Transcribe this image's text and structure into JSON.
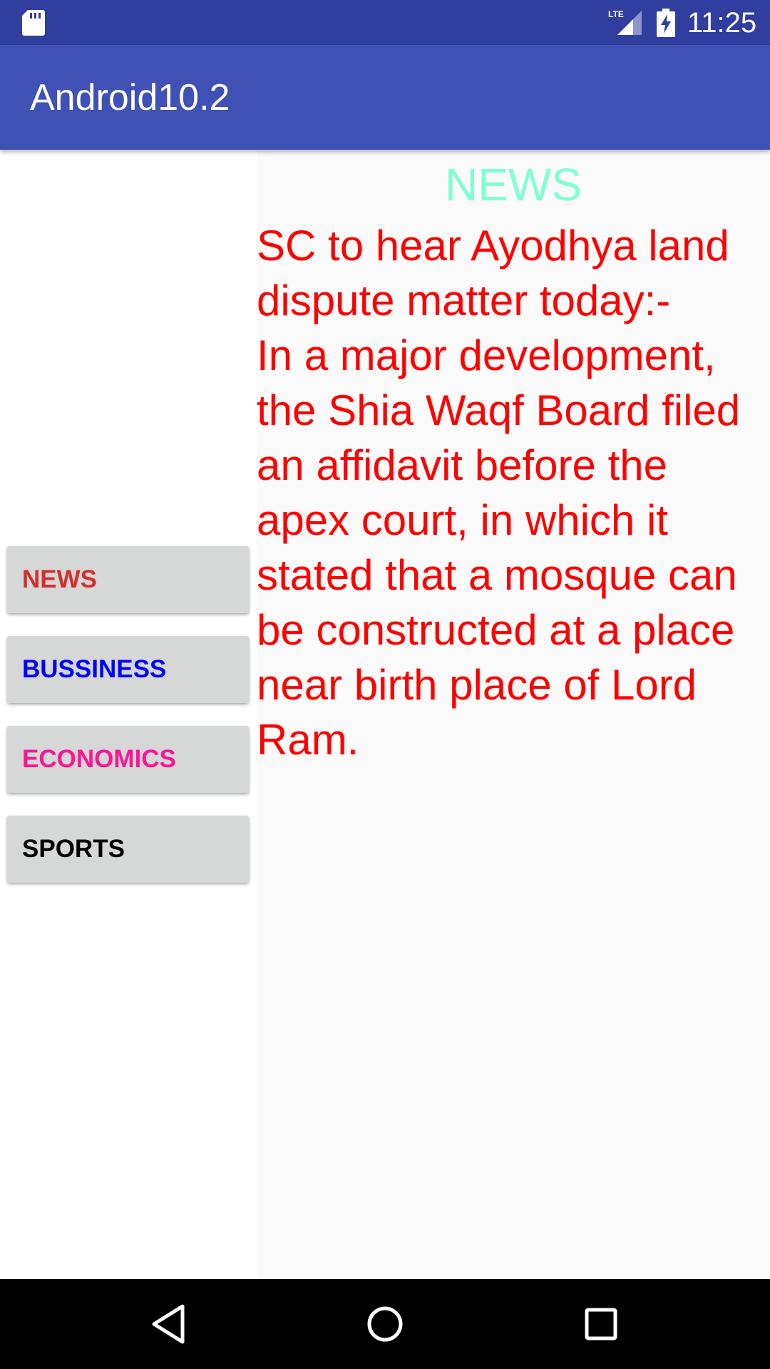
{
  "status_bar": {
    "time": "11:25",
    "icons": [
      "sd-card-icon",
      "lte-signal-icon",
      "battery-charging-icon"
    ]
  },
  "app_bar": {
    "title": "Android10.2"
  },
  "menu": {
    "buttons": [
      {
        "label": "NEWS",
        "color": "#d32f2f"
      },
      {
        "label": "BUSSINESS",
        "color": "#0000ff"
      },
      {
        "label": "ECONOMICS",
        "color": "#ff1493"
      },
      {
        "label": "SPORTS",
        "color": "#000000"
      }
    ]
  },
  "content": {
    "heading": "NEWS",
    "heading_color": "#7FFFD4",
    "body": "SC to hear Ayodhya land dispute matter today:-\nIn a major development, the Shia Waqf Board filed an affidavit before the apex court, in which it stated that a mosque can be constructed at a place near birth place of Lord Ram.",
    "body_color": "#ff0000"
  },
  "nav_bar": {
    "icons": [
      "back-icon",
      "home-icon",
      "recents-icon"
    ]
  },
  "colors": {
    "status_bar": "#303F9F",
    "app_bar": "#3F51B5",
    "button_bg": "#d6d7d7"
  }
}
